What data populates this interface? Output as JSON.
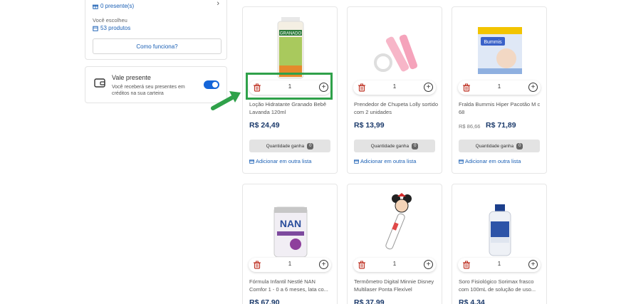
{
  "sidebar": {
    "gifts_text": "0 presente(s)",
    "chose_label": "Você escolheu",
    "products_text": "53 produtos",
    "how_button": "Como funciona?",
    "vale": {
      "title": "Vale presente",
      "description": "Você receberá seu presentes em créditos na sua carteira",
      "toggle_on": true
    }
  },
  "product_common": {
    "won_label": "Quantidade ganha",
    "add_list_label": "Adicionar em outra lista"
  },
  "products": [
    {
      "name": "Loção Hidratante Granado Bebê Lavanda 120ml",
      "price": "R$ 24,49",
      "quantity": "1",
      "won_count": "0",
      "image_label": "GRANADO"
    },
    {
      "name": "Prendedor de Chupeta Lolly sortido com 2 unidades",
      "price": "R$ 13,99",
      "quantity": "1",
      "won_count": "0"
    },
    {
      "name": "Fralda Bummis Hiper Pacotão M c 68",
      "old_price": "R$ 86,66",
      "price": "R$ 71,89",
      "quantity": "1",
      "won_count": "0",
      "image_label": "Bummis"
    },
    {
      "name": "Fórmula Infantil Nestlé NAN Comfor 1 - 0 a 6 meses, lata co...",
      "price": "R$ 67,90",
      "quantity": "1",
      "image_label": "NAN"
    },
    {
      "name": "Termômetro Digital Minnie Disney Multilaser Ponta Flexível",
      "price": "R$ 37,99",
      "quantity": "1"
    },
    {
      "name": "Soro Fisiológico Sorimax frasco com 100mL de solução de uso...",
      "price": "R$ 4,34",
      "quantity": "1"
    }
  ],
  "colors": {
    "link": "#1a5fb4",
    "price": "#1b3a6b",
    "toggle": "#1565d8",
    "highlight": "#2fa14a",
    "trash": "#c0392b"
  }
}
